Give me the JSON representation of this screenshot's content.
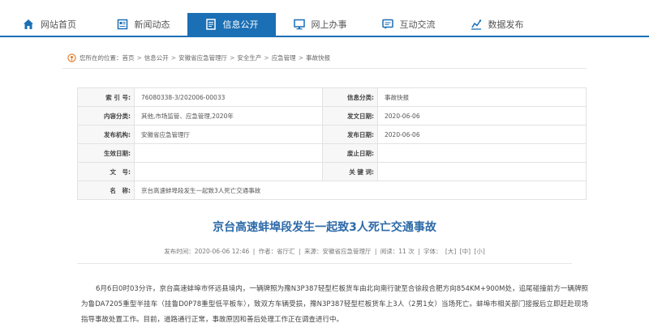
{
  "nav": {
    "items": [
      {
        "label": "网站首页",
        "icon": "home-icon"
      },
      {
        "label": "新闻动态",
        "icon": "news-icon"
      },
      {
        "label": "信息公开",
        "icon": "document-icon",
        "active": true
      },
      {
        "label": "网上办事",
        "icon": "monitor-icon"
      },
      {
        "label": "互动交流",
        "icon": "chat-icon"
      },
      {
        "label": "数据发布",
        "icon": "chart-icon"
      }
    ],
    "active_color": "#1a6fb5"
  },
  "breadcrumb": {
    "prefix": "您所在的位置：",
    "items": [
      "首页",
      "信息公开",
      "安徽省应急管理厅",
      "安全生产",
      "应急管理",
      "事故快报"
    ]
  },
  "info_table": {
    "index_label": "索 引 号:",
    "index_value": "76080338-3/202006-00033",
    "category_label": "信息分类:",
    "category_value": "事故快报",
    "content_label": "内容分类:",
    "content_value": "其他,市场监管、应急管理,2020年",
    "date_label": "发文日期:",
    "date_value": "2020-06-06",
    "org_label": "发布机构:",
    "org_value": "安徽省应急管理厅",
    "pub_label": "发布日期:",
    "pub_value": "2020-06-06",
    "effective_label": "生效日期:",
    "effective_value": "",
    "expire_label": "废止日期:",
    "expire_value": "",
    "docno_label": "文　号:",
    "docno_value": "",
    "keywords_label": "关 键 词:",
    "keywords_value": "",
    "name_label": "名　称:",
    "name_value": "京台高速蚌埠段发生一起致3人死亡交通事故"
  },
  "article": {
    "title": "京台高速蚌埠段发生一起致3人死亡交通事故",
    "meta_time": "发布时间：2020-06-06 12:46",
    "meta_author": "作者：省厅汇",
    "meta_source": "来源：安徽省应急管理厅",
    "meta_views": "阅读：11 次",
    "meta_font": "字体：",
    "font_large": "[大]",
    "font_medium": "[中]",
    "font_small": "[小]",
    "body": "6月6日0时03分许，京台高速蚌埠市怀远县境内，一辆牌照为豫N3P387轻型栏板货车由北向南行驶至合徐段合肥方向854KM+900M处，追尾碰撞前方一辆牌照为鲁DA7205重型半挂车（挂鲁D0P78重型低平板车），致双方车辆受损，豫N3P387轻型栏板货车上3人（2男1女）当场死亡。蚌埠市相关部门接报后立即赶赴现场指导事故处置工作。目前，道路通行正常，事故原因和善后处理工作正在调查进行中。"
  }
}
